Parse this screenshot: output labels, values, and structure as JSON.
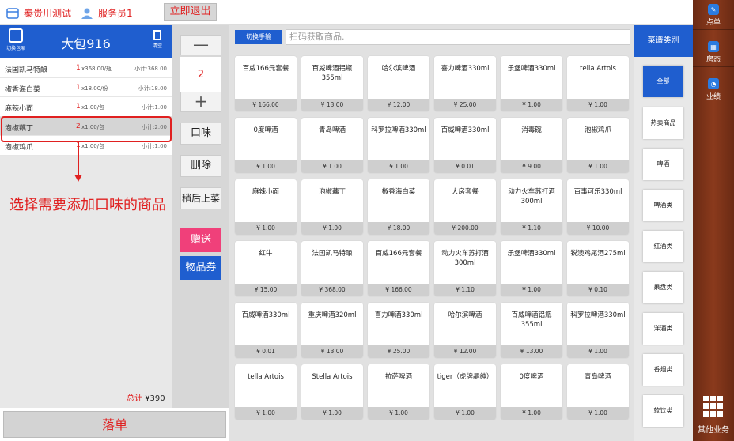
{
  "topbar": {
    "store_name": "秦贵川测试",
    "user_name": "服务员1",
    "exit_label": "立即退出"
  },
  "order": {
    "switch_table_label": "切换包厢",
    "table_name": "大包916",
    "clear_label": "清空",
    "items": [
      {
        "name": "法国凯马特酿",
        "qty": "1",
        "price": "x368.00/瓶",
        "subtotal": "小计:368.00"
      },
      {
        "name": "椒香海白菜",
        "qty": "1",
        "price": "x18.00/份",
        "subtotal": "小计:18.00"
      },
      {
        "name": "麻辣小面",
        "qty": "1",
        "price": "x1.00/包",
        "subtotal": "小计:1.00"
      },
      {
        "name": "泡椒藕丁",
        "qty": "2",
        "price": "x1.00/包",
        "subtotal": "小计:2.00"
      },
      {
        "name": "泡椒鸡爪",
        "qty": "1",
        "price": "x1.00/包",
        "subtotal": "小计:1.00"
      }
    ],
    "annotation": "选择需要添加口味的商品",
    "total_label": "总计",
    "total_value": "¥390",
    "submit_label": "落单"
  },
  "controls": {
    "minus": "—",
    "quantity": "2",
    "plus": "+",
    "flavor": "口味",
    "delete": "删除",
    "later": "稍后上菜",
    "gift": "赠送",
    "voucher": "物品券"
  },
  "search": {
    "switch_input_label": "切换手输",
    "placeholder": "扫码获取商品."
  },
  "products": [
    {
      "name": "百威166元套餐",
      "price": "¥ 166.00"
    },
    {
      "name": "百威啤酒铝瓶355ml",
      "price": "¥ 13.00"
    },
    {
      "name": "哈尔滨啤酒",
      "price": "¥ 12.00"
    },
    {
      "name": "喜力啤酒330ml",
      "price": "¥ 25.00"
    },
    {
      "name": "乐堡啤酒330ml",
      "price": "¥ 1.00"
    },
    {
      "name": "tella Artois",
      "price": "¥ 1.00"
    },
    {
      "name": "0度啤酒",
      "price": "¥ 1.00"
    },
    {
      "name": "青岛啤酒",
      "price": "¥ 1.00"
    },
    {
      "name": "科罗拉啤酒330ml",
      "price": "¥ 1.00"
    },
    {
      "name": "百威啤酒330ml",
      "price": "¥ 0.01"
    },
    {
      "name": "消毒碗",
      "price": "¥ 9.00"
    },
    {
      "name": "泡椒鸡爪",
      "price": "¥ 1.00"
    },
    {
      "name": "麻辣小面",
      "price": "¥ 1.00"
    },
    {
      "name": "泡椒藕丁",
      "price": "¥ 1.00"
    },
    {
      "name": "椒香海白菜",
      "price": "¥ 18.00"
    },
    {
      "name": "大房套餐",
      "price": "¥ 200.00"
    },
    {
      "name": "动力火车苏打酒300ml",
      "price": "¥ 1.10"
    },
    {
      "name": "百事可乐330ml",
      "price": "¥ 10.00"
    },
    {
      "name": "红牛",
      "price": "¥ 15.00"
    },
    {
      "name": "法国凯马特酿",
      "price": "¥ 368.00"
    },
    {
      "name": "百威166元套餐",
      "price": "¥ 166.00"
    },
    {
      "name": "动力火车苏打酒300ml",
      "price": "¥ 1.10"
    },
    {
      "name": "乐堡啤酒330ml",
      "price": "¥ 1.00"
    },
    {
      "name": "锐澳鸡尾酒275ml",
      "price": "¥ 0.10"
    },
    {
      "name": "百威啤酒330ml",
      "price": "¥ 0.01"
    },
    {
      "name": "重庆啤酒320ml",
      "price": "¥ 13.00"
    },
    {
      "name": "喜力啤酒330ml",
      "price": "¥ 25.00"
    },
    {
      "name": "哈尔滨啤酒",
      "price": "¥ 12.00"
    },
    {
      "name": "百威啤酒铝瓶355ml",
      "price": "¥ 13.00"
    },
    {
      "name": "科罗拉啤酒330ml",
      "price": "¥ 1.00"
    },
    {
      "name": "tella Artois",
      "price": "¥ 1.00"
    },
    {
      "name": "Stella Artois",
      "price": "¥ 1.00"
    },
    {
      "name": "拉萨啤酒",
      "price": "¥ 1.00"
    },
    {
      "name": "tiger（虎牌晶纯）",
      "price": "¥ 1.00"
    },
    {
      "name": "0度啤酒",
      "price": "¥ 1.00"
    },
    {
      "name": "青岛啤酒",
      "price": "¥ 1.00"
    }
  ],
  "categories": {
    "header": "菜谱类别",
    "items": [
      "全部",
      "热卖商品",
      "啤酒",
      "啤酒类",
      "红酒类",
      "果盘类",
      "洋酒类",
      "香烟类",
      "软饮类"
    ]
  },
  "sidebar": {
    "items": [
      "点单",
      "房态",
      "业绩"
    ],
    "other_label": "其他业务"
  },
  "colors": {
    "accent_blue": "#1f5ecf",
    "alert_red": "#e02020",
    "gift_pink": "#f0407a"
  }
}
